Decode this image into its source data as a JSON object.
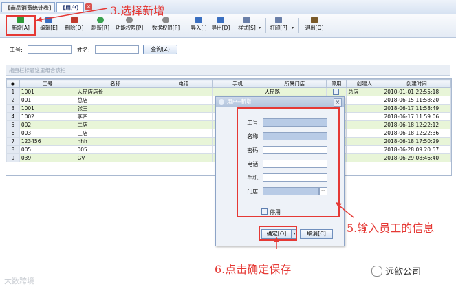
{
  "tabs": [
    {
      "label": "【商品消费统计表】",
      "active": false
    },
    {
      "label": "【用户】",
      "active": true
    }
  ],
  "tab_close": "×",
  "toolbar": {
    "items": [
      {
        "label": "新增[A]",
        "icon": "add-icon",
        "color": "#2e9a3a"
      },
      {
        "label": "编辑[E]",
        "icon": "edit-icon",
        "color": "#3a6fc0"
      },
      {
        "label": "删除[D]",
        "icon": "delete-icon",
        "color": "#c0392b"
      },
      {
        "label": "刷新[R]",
        "icon": "refresh-icon",
        "color": "#3aa150"
      },
      {
        "label": "功能权限[P]",
        "icon": "function-permission-icon",
        "color": "#8a8a8a"
      },
      {
        "label": "数据权限[P]",
        "icon": "data-permission-icon",
        "color": "#8a8a8a"
      },
      {
        "label": "导入[I]",
        "icon": "import-icon",
        "color": "#3a6fc0"
      },
      {
        "label": "导出[D]",
        "icon": "export-icon",
        "color": "#3a6fc0"
      },
      {
        "label": "样式[S]",
        "icon": "style-icon",
        "color": "#6a7fa8"
      },
      {
        "label": "打印[P]",
        "icon": "print-icon",
        "color": "#6a7fa8"
      },
      {
        "label": "退出[Q]",
        "icon": "exit-icon",
        "color": "#7a5a2a"
      }
    ],
    "dropdown_glyph": "▾"
  },
  "query": {
    "emp_no_label": "工号:",
    "name_label": "姓名:",
    "query_button": "查询(Z)"
  },
  "group_bar_hint": "拖曳栏标题这里组合该栏",
  "grid": {
    "columns": [
      "工号",
      "名称",
      "电话",
      "手机",
      "所属门店",
      "停用",
      "创建人",
      "创建时间"
    ],
    "rows": [
      {
        "n": "1",
        "id": "1001",
        "name": "人民店店长",
        "phone": "",
        "mobile": "",
        "store": "人民路",
        "creator": "总店",
        "created": "2010-01-01 22:55:18"
      },
      {
        "n": "2",
        "id": "001",
        "name": "总店",
        "phone": "",
        "mobile": "",
        "store": "",
        "creator": "",
        "created": "2018-06-15 11:58:20"
      },
      {
        "n": "3",
        "id": "1001",
        "name": "张三",
        "phone": "",
        "mobile": "",
        "store": "",
        "creator": "",
        "created": "2018-06-17 11:58:49"
      },
      {
        "n": "4",
        "id": "1002",
        "name": "李四",
        "phone": "",
        "mobile": "",
        "store": "",
        "creator": "",
        "created": "2018-06-17 11:59:06"
      },
      {
        "n": "5",
        "id": "002",
        "name": "二店",
        "phone": "",
        "mobile": "",
        "store": "",
        "creator": "",
        "created": "2018-06-18 12:22:12"
      },
      {
        "n": "6",
        "id": "003",
        "name": "三店",
        "phone": "",
        "mobile": "",
        "store": "",
        "creator": "",
        "created": "2018-06-18 12:22:36"
      },
      {
        "n": "7",
        "id": "123456",
        "name": "hhh",
        "phone": "",
        "mobile": "",
        "store": "",
        "creator": "",
        "created": "2018-06-18 17:50:29"
      },
      {
        "n": "8",
        "id": "005",
        "name": "005",
        "phone": "",
        "mobile": "",
        "store": "",
        "creator": "",
        "created": "2018-06-28 09:20:57"
      },
      {
        "n": "9",
        "id": "039",
        "name": "GV",
        "phone": "",
        "mobile": "",
        "store": "",
        "creator": "",
        "created": "2018-06-29 08:46:40"
      }
    ]
  },
  "dialog": {
    "title": "用户--新增",
    "close": "×",
    "fields": [
      {
        "label": "工号:",
        "required": true
      },
      {
        "label": "名称:",
        "required": true
      },
      {
        "label": "密码:",
        "required": false
      },
      {
        "label": "电话:",
        "required": false
      },
      {
        "label": "手机:",
        "required": false
      },
      {
        "label": "门店:",
        "required": true
      }
    ],
    "lookup_glyph": "···",
    "disabled_label": "停用",
    "ok_button": "确定[O]",
    "cancel_button": "取消[C]"
  },
  "annotations": {
    "step3": "3.选择新增",
    "step5": "5.输入员工的信息",
    "step6": "6.点击确定保存",
    "color": "#e53935"
  },
  "watermarks": {
    "bottom_left": "大数跨境",
    "bottom_right": "远歆公司"
  }
}
